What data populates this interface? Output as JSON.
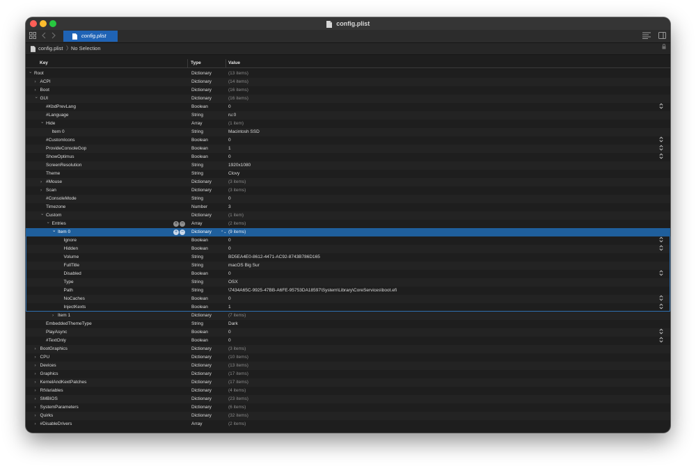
{
  "window": {
    "title": "config.plist",
    "tab_label": "config.plist"
  },
  "toolbar": {
    "grid_icon": "grid-icon",
    "back_icon": "chevron-left-icon",
    "forward_icon": "chevron-right-icon",
    "list_icon": "text-align-icon",
    "sidebar_icon": "sidebar-toggle-icon"
  },
  "breadcrumb": {
    "file": "config.plist",
    "separator": "〉",
    "selection": "No Selection"
  },
  "columns": {
    "key": "Key",
    "type": "Type",
    "value": "Value"
  },
  "rows": [
    {
      "depth": 0,
      "disc": "open",
      "key": "Root",
      "type": "Dictionary",
      "value": "(13 items)",
      "muted": true
    },
    {
      "depth": 1,
      "disc": "closed",
      "key": "ACPI",
      "type": "Dictionary",
      "value": "(14 items)",
      "muted": true
    },
    {
      "depth": 1,
      "disc": "closed",
      "key": "Boot",
      "type": "Dictionary",
      "value": "(16 items)",
      "muted": true
    },
    {
      "depth": 1,
      "disc": "open",
      "key": "GUI",
      "type": "Dictionary",
      "value": "(16 items)",
      "muted": true
    },
    {
      "depth": 2,
      "disc": "none",
      "key": "#KbdPrevLang",
      "type": "Boolean",
      "value": "0",
      "stepper": true
    },
    {
      "depth": 2,
      "disc": "none",
      "key": "#Language",
      "type": "String",
      "value": "ru:0"
    },
    {
      "depth": 2,
      "disc": "open",
      "key": "Hide",
      "type": "Array",
      "value": "(1 item)",
      "muted": true
    },
    {
      "depth": 3,
      "disc": "none",
      "key": "Item 0",
      "type": "String",
      "value": "Macintosh SSD"
    },
    {
      "depth": 2,
      "disc": "none",
      "key": "#CustomIcons",
      "type": "Boolean",
      "value": "0",
      "stepper": true
    },
    {
      "depth": 2,
      "disc": "none",
      "key": "ProvideConsoleGop",
      "type": "Boolean",
      "value": "1",
      "stepper": true
    },
    {
      "depth": 2,
      "disc": "none",
      "key": "ShowOptimus",
      "type": "Boolean",
      "value": "0",
      "stepper": true
    },
    {
      "depth": 2,
      "disc": "none",
      "key": "ScreenResolution",
      "type": "String",
      "value": "1920x1080"
    },
    {
      "depth": 2,
      "disc": "none",
      "key": "Theme",
      "type": "String",
      "value": "Clovy"
    },
    {
      "depth": 2,
      "disc": "closed",
      "key": "#Mouse",
      "type": "Dictionary",
      "value": "(3 items)",
      "muted": true
    },
    {
      "depth": 2,
      "disc": "closed",
      "key": "Scan",
      "type": "Dictionary",
      "value": "(3 items)",
      "muted": true
    },
    {
      "depth": 2,
      "disc": "none",
      "key": "#ConsoleMode",
      "type": "String",
      "value": "0"
    },
    {
      "depth": 2,
      "disc": "none",
      "key": "Timezone",
      "type": "Number",
      "value": "3"
    },
    {
      "depth": 2,
      "disc": "open",
      "key": "Custom",
      "type": "Dictionary",
      "value": "(1 item)",
      "muted": true
    },
    {
      "depth": 3,
      "disc": "open",
      "key": "Entries",
      "type": "Array",
      "value": "(2 items)",
      "muted": true,
      "rowbtns": true
    },
    {
      "depth": 4,
      "disc": "open",
      "key": "Item 0",
      "type": "Dictionary",
      "value": "(9 items)",
      "muted": true,
      "selected": true,
      "rowbtns": true,
      "type_stepper": true
    },
    {
      "depth": 5,
      "disc": "none",
      "key": "Ignore",
      "type": "Boolean",
      "value": "0",
      "stepper": true,
      "child": true
    },
    {
      "depth": 5,
      "disc": "none",
      "key": "Hidden",
      "type": "Boolean",
      "value": "0",
      "stepper": true,
      "child": true
    },
    {
      "depth": 5,
      "disc": "none",
      "key": "Volume",
      "type": "String",
      "value": "BD5EA4E0-8612-4471-AC92-8743B786D165",
      "child": true
    },
    {
      "depth": 5,
      "disc": "none",
      "key": "FullTitle",
      "type": "String",
      "value": "macOS Big Sur",
      "child": true
    },
    {
      "depth": 5,
      "disc": "none",
      "key": "Disabled",
      "type": "Boolean",
      "value": "0",
      "stepper": true,
      "child": true
    },
    {
      "depth": 5,
      "disc": "none",
      "key": "Type",
      "type": "String",
      "value": "OSX",
      "child": true
    },
    {
      "depth": 5,
      "disc": "none",
      "key": "Path",
      "type": "String",
      "value": "\\7434A65C-9925-47BB-A6FE-95753DA18597\\System\\Library\\CoreServices\\boot.efi",
      "child": true
    },
    {
      "depth": 5,
      "disc": "none",
      "key": "NoCaches",
      "type": "Boolean",
      "value": "0",
      "stepper": true,
      "child": true
    },
    {
      "depth": 5,
      "disc": "none",
      "key": "InjectKexts",
      "type": "Boolean",
      "value": "1",
      "stepper": true,
      "child": true,
      "child_last": true
    },
    {
      "depth": 4,
      "disc": "closed",
      "key": "Item 1",
      "type": "Dictionary",
      "value": "(7 items)",
      "muted": true
    },
    {
      "depth": 2,
      "disc": "none",
      "key": "EmbeddedThemeType",
      "type": "String",
      "value": "Dark"
    },
    {
      "depth": 2,
      "disc": "none",
      "key": "PlayAsync",
      "type": "Boolean",
      "value": "0",
      "stepper": true
    },
    {
      "depth": 2,
      "disc": "none",
      "key": "#TextOnly",
      "type": "Boolean",
      "value": "0",
      "stepper": true
    },
    {
      "depth": 1,
      "disc": "closed",
      "key": "BootGraphics",
      "type": "Dictionary",
      "value": "(3 items)",
      "muted": true
    },
    {
      "depth": 1,
      "disc": "closed",
      "key": "CPU",
      "type": "Dictionary",
      "value": "(10 items)",
      "muted": true
    },
    {
      "depth": 1,
      "disc": "closed",
      "key": "Devices",
      "type": "Dictionary",
      "value": "(13 items)",
      "muted": true
    },
    {
      "depth": 1,
      "disc": "closed",
      "key": "Graphics",
      "type": "Dictionary",
      "value": "(17 items)",
      "muted": true
    },
    {
      "depth": 1,
      "disc": "closed",
      "key": "KernelAndKextPatches",
      "type": "Dictionary",
      "value": "(17 items)",
      "muted": true
    },
    {
      "depth": 1,
      "disc": "closed",
      "key": "RtVariables",
      "type": "Dictionary",
      "value": "(4 items)",
      "muted": true
    },
    {
      "depth": 1,
      "disc": "closed",
      "key": "SMBIOS",
      "type": "Dictionary",
      "value": "(23 items)",
      "muted": true
    },
    {
      "depth": 1,
      "disc": "closed",
      "key": "SystemParameters",
      "type": "Dictionary",
      "value": "(6 items)",
      "muted": true
    },
    {
      "depth": 1,
      "disc": "closed",
      "key": "Quirks",
      "type": "Dictionary",
      "value": "(32 items)",
      "muted": true
    },
    {
      "depth": 1,
      "disc": "closed",
      "key": "#DisableDrivers",
      "type": "Array",
      "value": "(2 items)",
      "muted": true
    }
  ]
}
